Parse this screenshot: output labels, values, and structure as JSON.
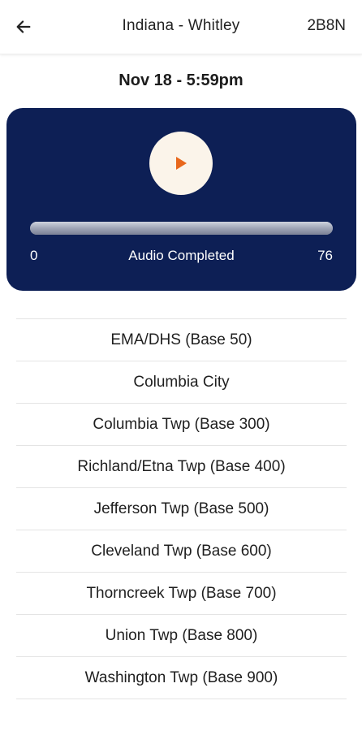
{
  "header": {
    "back_icon": "arrow-left-icon",
    "title": "Indiana - Whitley",
    "code": "2B8N"
  },
  "recording": {
    "datetime": "Nov 18 - 5:59pm"
  },
  "player": {
    "play_icon": "play-icon",
    "play_icon_color": "#e8671c",
    "background_color": "#0d1f55",
    "start_label": "0",
    "end_label": "76",
    "status": "Audio Completed",
    "progress_fraction": 1.0
  },
  "list": {
    "items": [
      {
        "label": "EMA/DHS (Base 50)"
      },
      {
        "label": "Columbia City"
      },
      {
        "label": "Columbia Twp (Base 300)"
      },
      {
        "label": "Richland/Etna Twp (Base 400)"
      },
      {
        "label": "Jefferson Twp (Base 500)"
      },
      {
        "label": "Cleveland Twp (Base 600)"
      },
      {
        "label": "Thorncreek Twp (Base 700)"
      },
      {
        "label": "Union Twp (Base 800)"
      },
      {
        "label": "Washington Twp (Base 900)"
      }
    ]
  }
}
